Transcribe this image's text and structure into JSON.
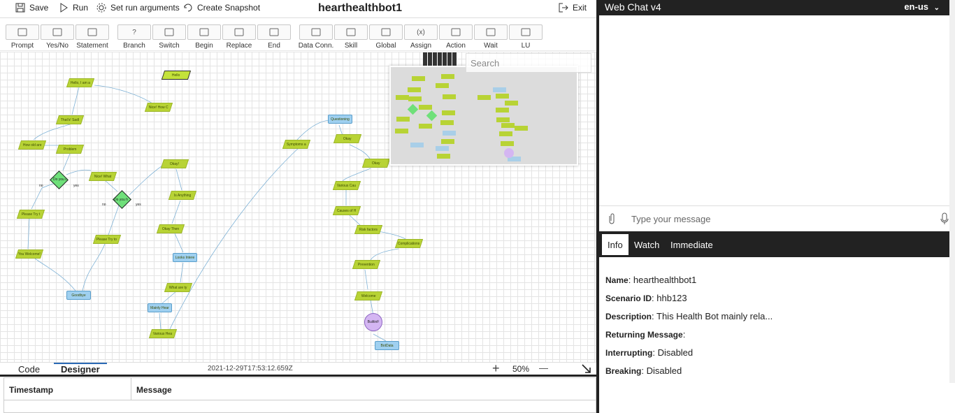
{
  "topbar": {
    "save_label": "Save",
    "run_label": "Run",
    "set_args_label": "Set run arguments",
    "snapshot_label": "Create Snapshot",
    "title": "hearthealthbot1",
    "exit_label": "Exit"
  },
  "toolbox": [
    {
      "label": "Prompt",
      "icon": "prompt-icon"
    },
    {
      "label": "Yes/No",
      "icon": "yes-no-icon"
    },
    {
      "label": "Statement",
      "icon": "statement-icon"
    },
    {
      "label": "Branch",
      "icon": "branch-icon",
      "glyph": "?"
    },
    {
      "label": "Switch",
      "icon": "switch-icon"
    },
    {
      "label": "Begin",
      "icon": "begin-icon"
    },
    {
      "label": "Replace",
      "icon": "replace-icon"
    },
    {
      "label": "End",
      "icon": "end-icon"
    },
    {
      "label": "Data Conn.",
      "icon": "data-connection-icon"
    },
    {
      "label": "Skill",
      "icon": "skill-icon"
    },
    {
      "label": "Global",
      "icon": "global-icon"
    },
    {
      "label": "Assign",
      "icon": "assign-icon",
      "glyph": "(x)"
    },
    {
      "label": "Action",
      "icon": "action-icon"
    },
    {
      "label": "Wait",
      "icon": "wait-icon"
    },
    {
      "label": "LU",
      "icon": "lu-icon"
    }
  ],
  "canvas": {
    "search_placeholder": "Search",
    "nodes": {
      "hello": "Hello",
      "hello_iam": "Hello, I am a",
      "nice": "Nice! How C",
      "thats": "That's! Sadl",
      "how_old": "How old are",
      "problem": "Problem",
      "do_you": "Do you c",
      "nice_what": "Nice! What",
      "do_you2": "Do you h",
      "please_try1": "Please Try t",
      "please_try2": "Please Try to",
      "you_welcome": "You Welcome!",
      "goodbye": "Goodbye",
      "okay1": "Okay!",
      "anything": "Is Anything",
      "okay_then": "Okay Then",
      "looks": "Looks Intere",
      "what_are": "What are ty",
      "mainly": "Mainly Hear",
      "various_hea": "Various Hea",
      "symptoms": "Symptoms a",
      "questioning": "Questioning",
      "okay2": "Okay",
      "okay3": "Okay",
      "various_cau": "Various Cau",
      "causes": "Causes of H",
      "risk": "Risk factors",
      "complications": "Complications",
      "prevention": "Prevention",
      "welcome": "Welcome",
      "builtin": "BuiltinF",
      "botdata": "BotData",
      "no": "no",
      "yes": "yes"
    }
  },
  "status": {
    "code_tab": "Code",
    "designer_tab": "Designer",
    "timestamp": "2021-12-29T17:53:12.659Z",
    "zoom": "50%",
    "zoom_in": "+",
    "zoom_out": "—"
  },
  "log": {
    "col_timestamp": "Timestamp",
    "col_message": "Message"
  },
  "webchat": {
    "title": "Web Chat v4",
    "language": "en-us",
    "input_placeholder": "Type your message"
  },
  "inspector": {
    "tabs": [
      "Info",
      "Watch",
      "Immediate"
    ],
    "active_tab": "Info",
    "fields": [
      {
        "label": "Name",
        "value": "hearthealthbot1"
      },
      {
        "label": "Scenario ID",
        "value": "hhb123"
      },
      {
        "label": "Description",
        "value": "This Health Bot mainly rela..."
      },
      {
        "label": "Returning Message",
        "value": ""
      },
      {
        "label": "Interrupting",
        "value": "Disabled"
      },
      {
        "label": "Breaking",
        "value": "Disabled"
      }
    ]
  },
  "colors": {
    "node_green": "#b8d335",
    "node_blue": "#9fd0f0",
    "decision": "#6fe07a",
    "end_circle": "#d4b6f2",
    "dark_bar": "#222222"
  }
}
